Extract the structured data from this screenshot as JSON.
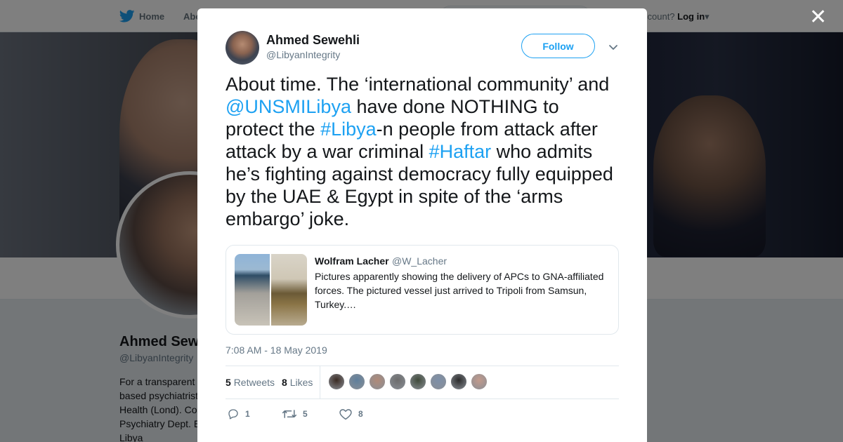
{
  "background": {
    "nav": {
      "home_label": "Home",
      "about_label": "Abo"
    },
    "login": {
      "prompt": "ccount?",
      "login_label": "Log in"
    },
    "profile": {
      "name": "Ahmed Sew",
      "handle": "@LibyanIntegrity",
      "bio_lines": [
        "For a transparent",
        "based psychiatrist",
        "Health (Lond). Co",
        "Psychiatry Dept. E",
        "Libya"
      ]
    }
  },
  "modal": {
    "author": {
      "name": "Ahmed Sewehli",
      "handle": "@LibyanIntegrity"
    },
    "follow_label": "Follow",
    "tweet": {
      "parts": [
        {
          "t": "About time. The ‘international community’ and ",
          "link": false
        },
        {
          "t": "@UNSMILibya",
          "link": true
        },
        {
          "t": " have done NOTHING to protect the ",
          "link": false
        },
        {
          "t": "#Libya",
          "link": true
        },
        {
          "t": "-n people from attack after attack by a war criminal ",
          "link": false
        },
        {
          "t": "#Haftar",
          "link": true
        },
        {
          "t": " who admits he’s fighting against democracy fully equipped by the UAE & Egypt in spite of the ‘arms embargo’ joke.",
          "link": false
        }
      ]
    },
    "quote": {
      "name": "Wolfram Lacher",
      "handle": "@W_Lacher",
      "text": "Pictures apparently showing the delivery of APCs to GNA-affiliated forces. The pictured vessel just arrived to Tripoli from Samsun, Turkey.…"
    },
    "timestamp": "7:08 AM - 18 May 2019",
    "stats": {
      "retweets_count": "5",
      "retweets_label": "Retweets",
      "likes_count": "8",
      "likes_label": "Likes"
    },
    "likers": [
      "#3a2a22",
      "#5f7f9c",
      "#b08a78",
      "#6c6c6c",
      "#3f4a3a",
      "#7d8fa8",
      "#2b2b2b",
      "#c29a8c"
    ],
    "actions": {
      "reply_count": "1",
      "retweet_count": "5",
      "like_count": "8"
    }
  },
  "colors": {
    "accent": "#1da1f2",
    "text": "#14171a",
    "secondary": "#657786"
  }
}
